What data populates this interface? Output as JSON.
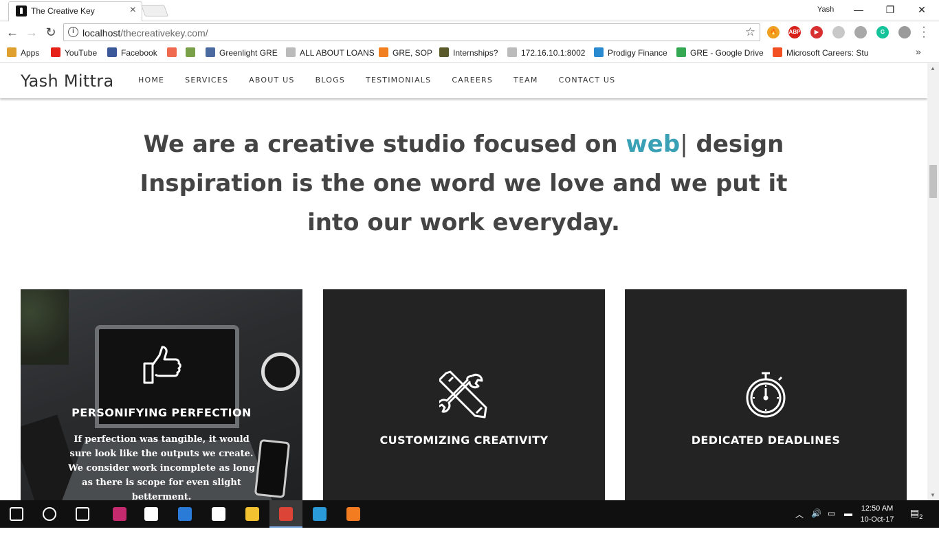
{
  "browser": {
    "tab_title": "The Creative Key",
    "tab_close": "×",
    "user": "Yash",
    "window_min": "—",
    "window_restore": "❐",
    "window_close": "✕",
    "back": "←",
    "forward": "→",
    "reload": "↻",
    "url_host": "localhost",
    "url_path": "/thecreativekey.com/",
    "star": "☆",
    "bookmarks": [
      {
        "label": "Apps",
        "color": "#e0a030"
      },
      {
        "label": "YouTube",
        "color": "#e62117"
      },
      {
        "label": "Facebook",
        "color": "#3b5998"
      },
      {
        "label": "",
        "color": "#f06a50"
      },
      {
        "label": "",
        "color": "#7aa04a"
      },
      {
        "label": "Greenlight GRE",
        "color": "#4a6aa0"
      },
      {
        "label": "ALL ABOUT LOANS",
        "color": "#bbbbbb"
      },
      {
        "label": "GRE, SOP",
        "color": "#f08020"
      },
      {
        "label": "Internships?",
        "color": "#5a5a2a"
      },
      {
        "label": "172.16.10.1:8002",
        "color": "#bbbbbb"
      },
      {
        "label": "Prodigy Finance",
        "color": "#2a8ad0"
      },
      {
        "label": "GRE - Google Drive",
        "color": "#34a853"
      },
      {
        "label": "Microsoft Careers: Stu",
        "color": "#f25022"
      }
    ],
    "bookmarks_more": "»",
    "extensions": [
      {
        "name": "fire-extension",
        "label": "🔥",
        "color": "#f0a020"
      },
      {
        "name": "adblock-extension",
        "label": "ABP",
        "color": "#d8201a"
      },
      {
        "name": "video-extension",
        "label": "▶",
        "color": "#d83030"
      },
      {
        "name": "docs-extension",
        "label": "",
        "color": "#c8c8c8"
      },
      {
        "name": "cloud-extension",
        "label": "",
        "color": "#a8a8a8"
      },
      {
        "name": "grammarly-extension",
        "label": "G",
        "color": "#15c39a"
      },
      {
        "name": "camera-extension",
        "label": "",
        "color": "#9a9a9a"
      }
    ]
  },
  "site": {
    "brand": "Yash Mittra",
    "nav": [
      "HOME",
      "SERVICES",
      "ABOUT US",
      "BLOGS",
      "TESTIMONIALS",
      "CAREERS",
      "TEAM",
      "CONTACT US"
    ],
    "hero": {
      "prefix": "We are a creative studio focused on ",
      "typed_word": "web",
      "cursor": "|",
      "suffix": " design",
      "tagline": "Inspiration is the one word we love and we put it into our work everyday.",
      "accent_color": "#3aa0b6"
    },
    "cards": [
      {
        "title": "PERSONIFYING PERFECTION",
        "icon": "thumbs-up-icon",
        "description": "If perfection was tangible, it would sure look like the outputs we create. We consider work incomplete as long as there is scope for even slight betterment."
      },
      {
        "title": "CUSTOMIZING CREATIVITY",
        "icon": "tools-icon"
      },
      {
        "title": "DEDICATED DEADLINES",
        "icon": "stopwatch-icon"
      }
    ]
  },
  "taskbar": {
    "time": "12:50 AM",
    "date": "10-Oct-17",
    "notifications": "2",
    "apps": [
      {
        "name": "start-button",
        "color": "#ffffff"
      },
      {
        "name": "cortana-button",
        "color": "#ffffff"
      },
      {
        "name": "task-view-button",
        "color": "#ffffff"
      },
      {
        "name": "intellij-app",
        "color": "#c62a6e"
      },
      {
        "name": "store-app",
        "color": "#ffffff"
      },
      {
        "name": "paint-app",
        "color": "#2a7ad8"
      },
      {
        "name": "iheart-app",
        "color": "#ffffff"
      },
      {
        "name": "explorer-app",
        "color": "#f2c230"
      },
      {
        "name": "chrome-app",
        "color": "#db4437"
      },
      {
        "name": "network-app",
        "color": "#2a9ad8"
      },
      {
        "name": "xampp-app",
        "color": "#f37c21"
      }
    ]
  }
}
